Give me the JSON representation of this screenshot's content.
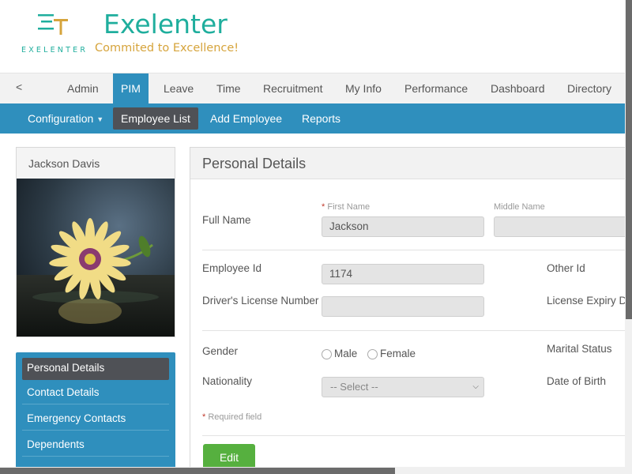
{
  "brand": {
    "logo_mark_icon": "et-logo-icon",
    "logo_small": "EXELENTER",
    "name": "Exelenter",
    "tagline": "Commited to Excellence!"
  },
  "mainnav": {
    "prev": "<",
    "items": [
      "Admin",
      "PIM",
      "Leave",
      "Time",
      "Recruitment",
      "My Info",
      "Performance",
      "Dashboard",
      "Directory"
    ],
    "active": "PIM"
  },
  "subnav": {
    "items": [
      "Configuration",
      "Employee List",
      "Add Employee",
      "Reports"
    ],
    "active": "Employee List"
  },
  "profile": {
    "name": "Jackson Davis"
  },
  "sidemenu": {
    "items": [
      "Personal Details",
      "Contact Details",
      "Emergency Contacts",
      "Dependents"
    ],
    "active": "Personal Details"
  },
  "details": {
    "title": "Personal Details",
    "full_name_label": "Full Name",
    "first_name_label": "First Name",
    "required_mark": "*",
    "first_name_value": "Jackson",
    "middle_name_label": "Middle Name",
    "middle_name_value": "",
    "employee_id_label": "Employee Id",
    "employee_id_value": "1174",
    "other_id_label": "Other Id",
    "license_label": "Driver's License Number",
    "license_value": "",
    "license_expiry_label": "License Expiry Da",
    "gender_label": "Gender",
    "gender_male": "Male",
    "gender_female": "Female",
    "marital_label": "Marital Status",
    "nationality_label": "Nationality",
    "nationality_value": "-- Select --",
    "dob_label": "Date of Birth",
    "required_note": "Required field",
    "edit_button": "Edit"
  },
  "colors": {
    "brand_teal": "#1fae9d",
    "brand_gold": "#d6a43c",
    "nav_blue": "#2f8fbd",
    "active_dark": "#4f5156",
    "edit_green": "#56b03f"
  }
}
